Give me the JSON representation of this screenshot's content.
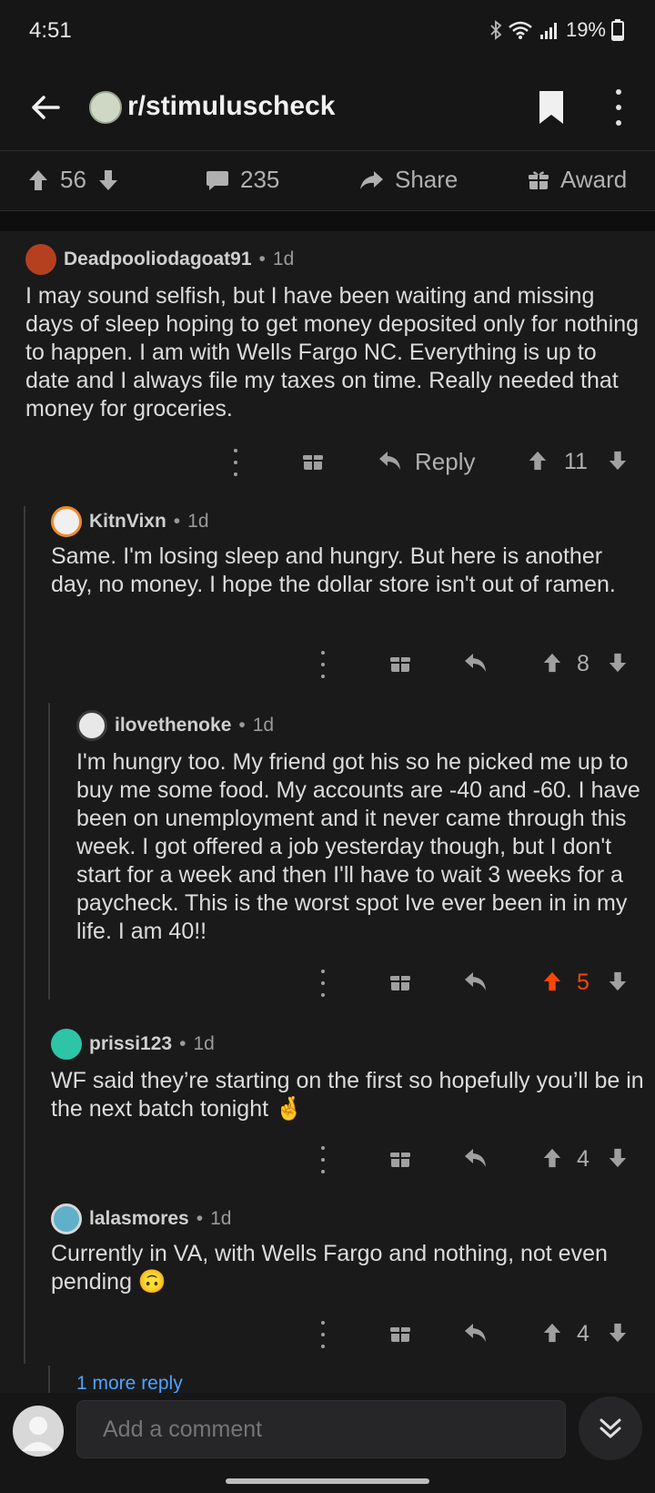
{
  "status": {
    "time": "4:51",
    "battery": "19%"
  },
  "header": {
    "subreddit": "r/stimuluscheck"
  },
  "post_actions": {
    "votes": "56",
    "comments": "235",
    "share": "Share",
    "award": "Award"
  },
  "comments": [
    {
      "user": "Deadpooliodagoat91",
      "age": "1d",
      "body": "I may sound selfish, but I have been waiting and missing days of sleep hoping to get money deposited only for nothing to happen. I am with Wells Fargo NC.  Everything is up to date and I  always file my taxes on time. Really needed that money for groceries.",
      "reply_label": "Reply",
      "votes": "11"
    },
    {
      "user": "KitnVixn",
      "age": "1d",
      "body": "Same. I'm losing sleep and hungry. But here is another day, no money. I hope the dollar store isn't out of ramen.",
      "votes": "8"
    },
    {
      "user": "ilovethenoke",
      "age": "1d",
      "body": "I'm hungry too. My friend got his so he picked me up to buy me some food. My accounts are -40 and -60. I have been on unemployment and it never came through this week. I got offered a job yesterday though, but I don't start for a week and then I'll have to wait 3 weeks for a paycheck. This is the worst spot Ive ever been in in my life. I am 40!!",
      "votes": "5",
      "upvoted": true
    },
    {
      "user": "prissi123",
      "age": "1d",
      "body": "WF said they’re starting on the first so hopefully you’ll be in the next batch tonight 🤞",
      "votes": "4"
    },
    {
      "user": "lalasmores",
      "age": "1d",
      "body": "Currently in VA, with Wells Fargo and nothing, not even pending 🙃",
      "votes": "4"
    }
  ],
  "more_replies": "1 more reply",
  "composer": {
    "placeholder": "Add a comment"
  },
  "colors": {
    "upvote_active": "#ff4500",
    "link": "#4fa3ff",
    "background": "#1a1a1b"
  }
}
